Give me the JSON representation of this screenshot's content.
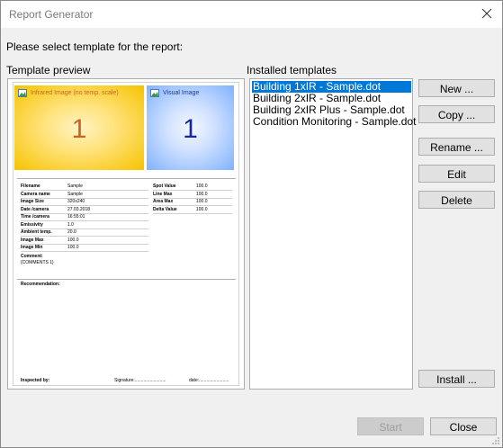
{
  "window": {
    "title": "Report Generator"
  },
  "prompt": "Please select template for the report:",
  "preview": {
    "label": "Template preview",
    "ir_image": {
      "label": "Infrared Image (no temp. scale)",
      "number": "1"
    },
    "visual_image": {
      "label": "Visual Image",
      "number": "1"
    },
    "fields_left": [
      {
        "label": "Filename",
        "value": "Sample"
      },
      {
        "label": "Camera name",
        "value": "Sample"
      },
      {
        "label": "Image Size",
        "value": "320x240"
      },
      {
        "label": "Date /camera",
        "value": "27.03.2018"
      },
      {
        "label": "Time /camera",
        "value": "16:55:01"
      },
      {
        "label": "Emissivity",
        "value": "1.0"
      },
      {
        "label": "Ambient temp.",
        "value": "20.0"
      },
      {
        "label": "Image Max",
        "value": "100.0"
      },
      {
        "label": "Image Min",
        "value": "100.0"
      }
    ],
    "fields_right": [
      {
        "label": "Spot Value",
        "value": "100.0"
      },
      {
        "label": "Line Max",
        "value": "100.0"
      },
      {
        "label": "Area Max",
        "value": "100.0"
      },
      {
        "label": "Delta Value",
        "value": "100.0"
      }
    ],
    "comment_label": "Comment:",
    "comment_value": "{COMMENTS 1}",
    "recommendation_label": "Recommendation:",
    "inspected_by": "Inspected by:",
    "signature": "Signature:.........................",
    "date": "date:........................"
  },
  "installed": {
    "label": "Installed templates",
    "items": [
      "Building 1xIR - Sample.dot",
      "Building 2xIR - Sample.dot",
      "Building 2xIR Plus - Sample.dot",
      "Condition Monitoring - Sample.dot"
    ],
    "selected_index": 0
  },
  "buttons": {
    "new": "New ...",
    "copy": "Copy ...",
    "rename": "Rename ...",
    "edit": "Edit",
    "delete": "Delete",
    "install": "Install ...",
    "start": "Start",
    "close": "Close"
  },
  "colors": {
    "selection": "#0078d7",
    "ir_number": "#c8641e",
    "visual_number": "#1428a0"
  }
}
